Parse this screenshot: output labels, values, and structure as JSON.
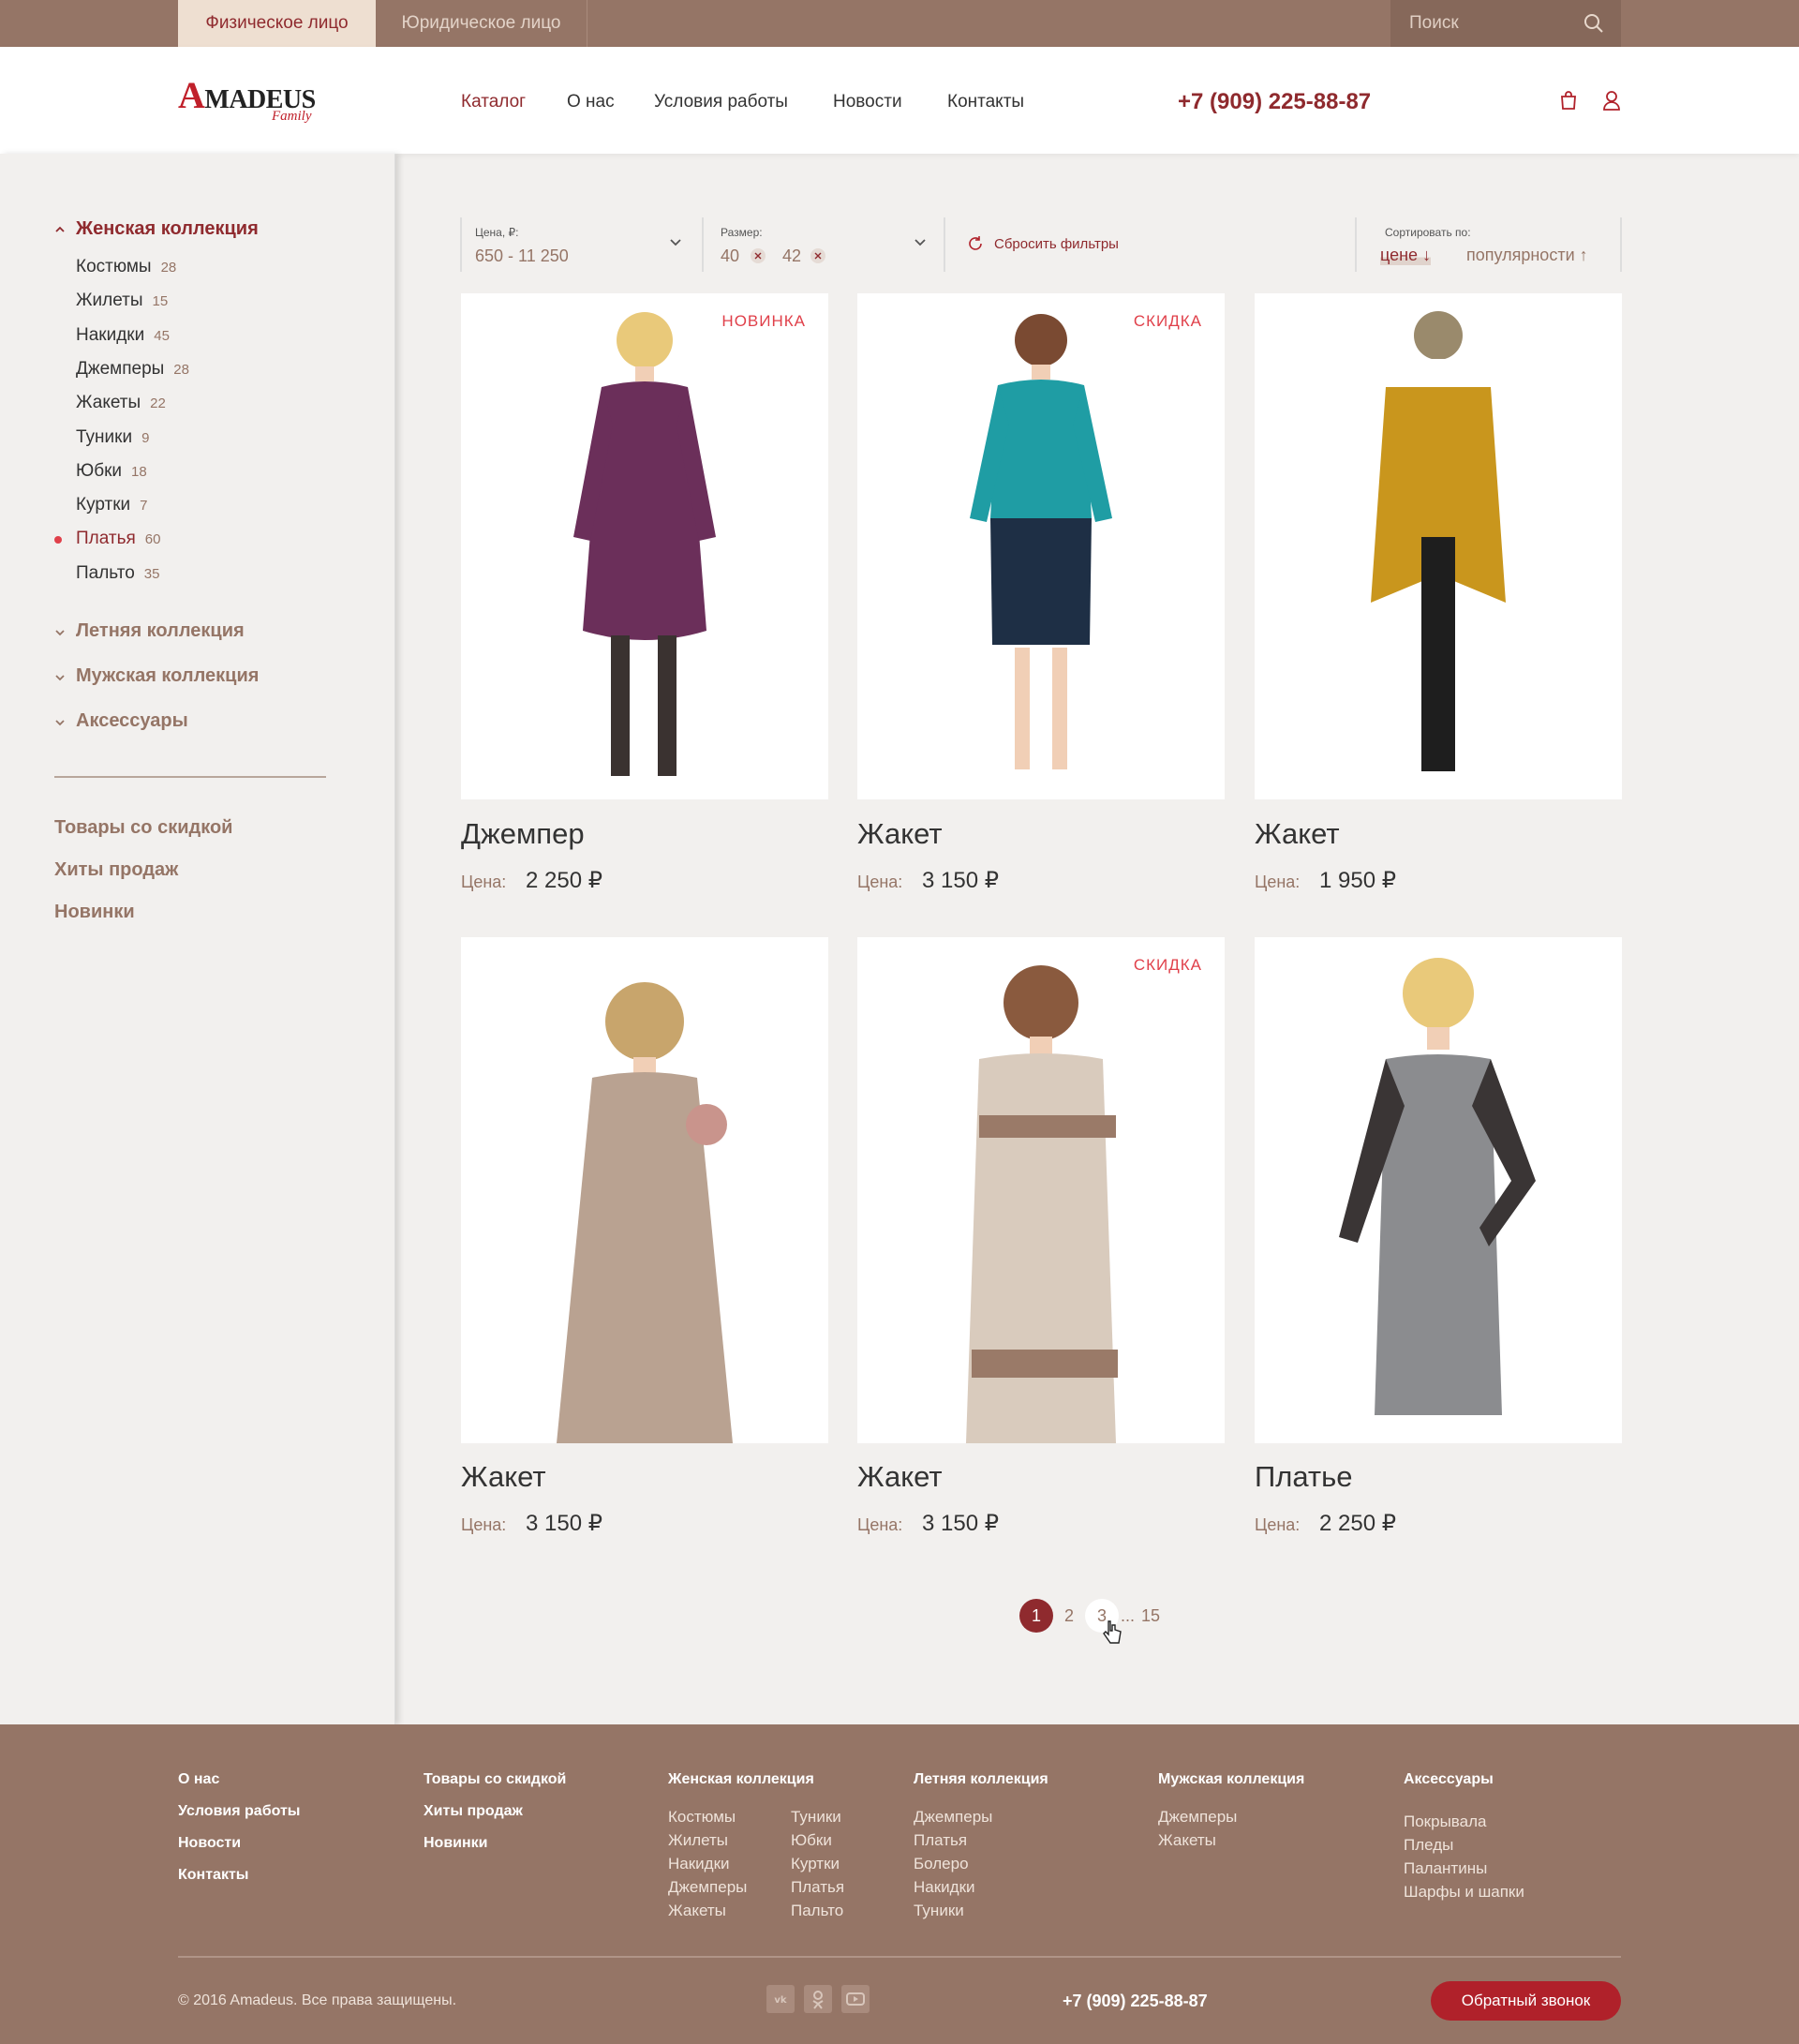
{
  "topbar": {
    "tab_person": "Физическое лицо",
    "tab_legal": "Юридическое лицо",
    "search_placeholder": "Поиск"
  },
  "header": {
    "logo_word": "MADEUS",
    "logo_letter": "A",
    "logo_sub": "Family",
    "nav": [
      "Каталог",
      "О нас",
      "Условия работы",
      "Новости",
      "Контакты"
    ],
    "phone": "+7 (909) 225-88-87",
    "icons": [
      "bag-icon",
      "user-icon"
    ]
  },
  "sidebar": {
    "women_title": "Женская коллекция",
    "women_items": [
      {
        "label": "Костюмы",
        "count": "28"
      },
      {
        "label": "Жилеты",
        "count": "15"
      },
      {
        "label": "Накидки",
        "count": "45"
      },
      {
        "label": "Джемперы",
        "count": "28"
      },
      {
        "label": "Жакеты",
        "count": "22"
      },
      {
        "label": "Туники",
        "count": "9"
      },
      {
        "label": "Юбки",
        "count": "18"
      },
      {
        "label": "Куртки",
        "count": "7"
      },
      {
        "label": "Платья",
        "count": "60"
      },
      {
        "label": "Пальто",
        "count": "35"
      }
    ],
    "summer_title": "Летняя коллекция",
    "men_title": "Мужская коллекция",
    "acc_title": "Аксессуары",
    "extra": [
      "Товары со скидкой",
      "Хиты продаж",
      "Новинки"
    ]
  },
  "filters": {
    "price_label": "Цена, ₽:",
    "price_value": "650 - 11 250",
    "size_label": "Размер:",
    "size_1": "40",
    "size_2": "42",
    "reset": "Сбросить фильтры",
    "sort_label": "Сортировать по:",
    "sort_price": "цене",
    "sort_pop": "популярности"
  },
  "products": [
    {
      "name": "Джемпер",
      "price_label": "Цена:",
      "price": "2 250 ₽",
      "badge": "НОВИНКА",
      "color": "#6b2f5a"
    },
    {
      "name": "Жакет",
      "price_label": "Цена:",
      "price": "3 150 ₽",
      "badge": "СКИДКА",
      "color": "#1f9da4"
    },
    {
      "name": "Жакет",
      "price_label": "Цена:",
      "price": "1 950 ₽",
      "badge": "",
      "color": "#c9961d"
    },
    {
      "name": "Жакет",
      "price_label": "Цена:",
      "price": "3 150 ₽",
      "badge": "",
      "color": "#b9a291"
    },
    {
      "name": "Жакет",
      "price_label": "Цена:",
      "price": "3 150 ₽",
      "badge": "СКИДКА",
      "color": "#d9cbbd"
    },
    {
      "name": "Платье",
      "price_label": "Цена:",
      "price": "2 250 ₽",
      "badge": "",
      "color": "#8b8c8f"
    }
  ],
  "pagination": {
    "p1": "1",
    "p2": "2",
    "p3": "3",
    "dots": "...",
    "last": "15"
  },
  "footer": {
    "col1": [
      "О нас",
      "Условия работы",
      "Новости",
      "Контакты"
    ],
    "col2": [
      "Товары со скидкой",
      "Хиты продаж",
      "Новинки"
    ],
    "women_title": "Женская коллекция",
    "women_a": [
      "Костюмы",
      "Жилеты",
      "Накидки",
      "Джемперы",
      "Жакеты"
    ],
    "women_b": [
      "Туники",
      "Юбки",
      "Куртки",
      "Платья",
      "Пальто"
    ],
    "summer_title": "Летняя коллекция",
    "summer": [
      "Джемперы",
      "Платья",
      "Болеро",
      "Накидки",
      "Туники"
    ],
    "men_title": "Мужская коллекция",
    "men": [
      "Джемперы",
      "Жакеты"
    ],
    "acc_title": "Аксессуары",
    "acc": [
      "Покрывала",
      "Пледы",
      "Палантины",
      "Шарфы и шапки"
    ],
    "copyright": "© 2016 Amadeus. Все права защищены.",
    "phone": "+7 (909) 225-88-87",
    "callback": "Обратный звонок",
    "social": [
      "vk-icon",
      "odnoklassniki-icon",
      "youtube-icon"
    ]
  }
}
